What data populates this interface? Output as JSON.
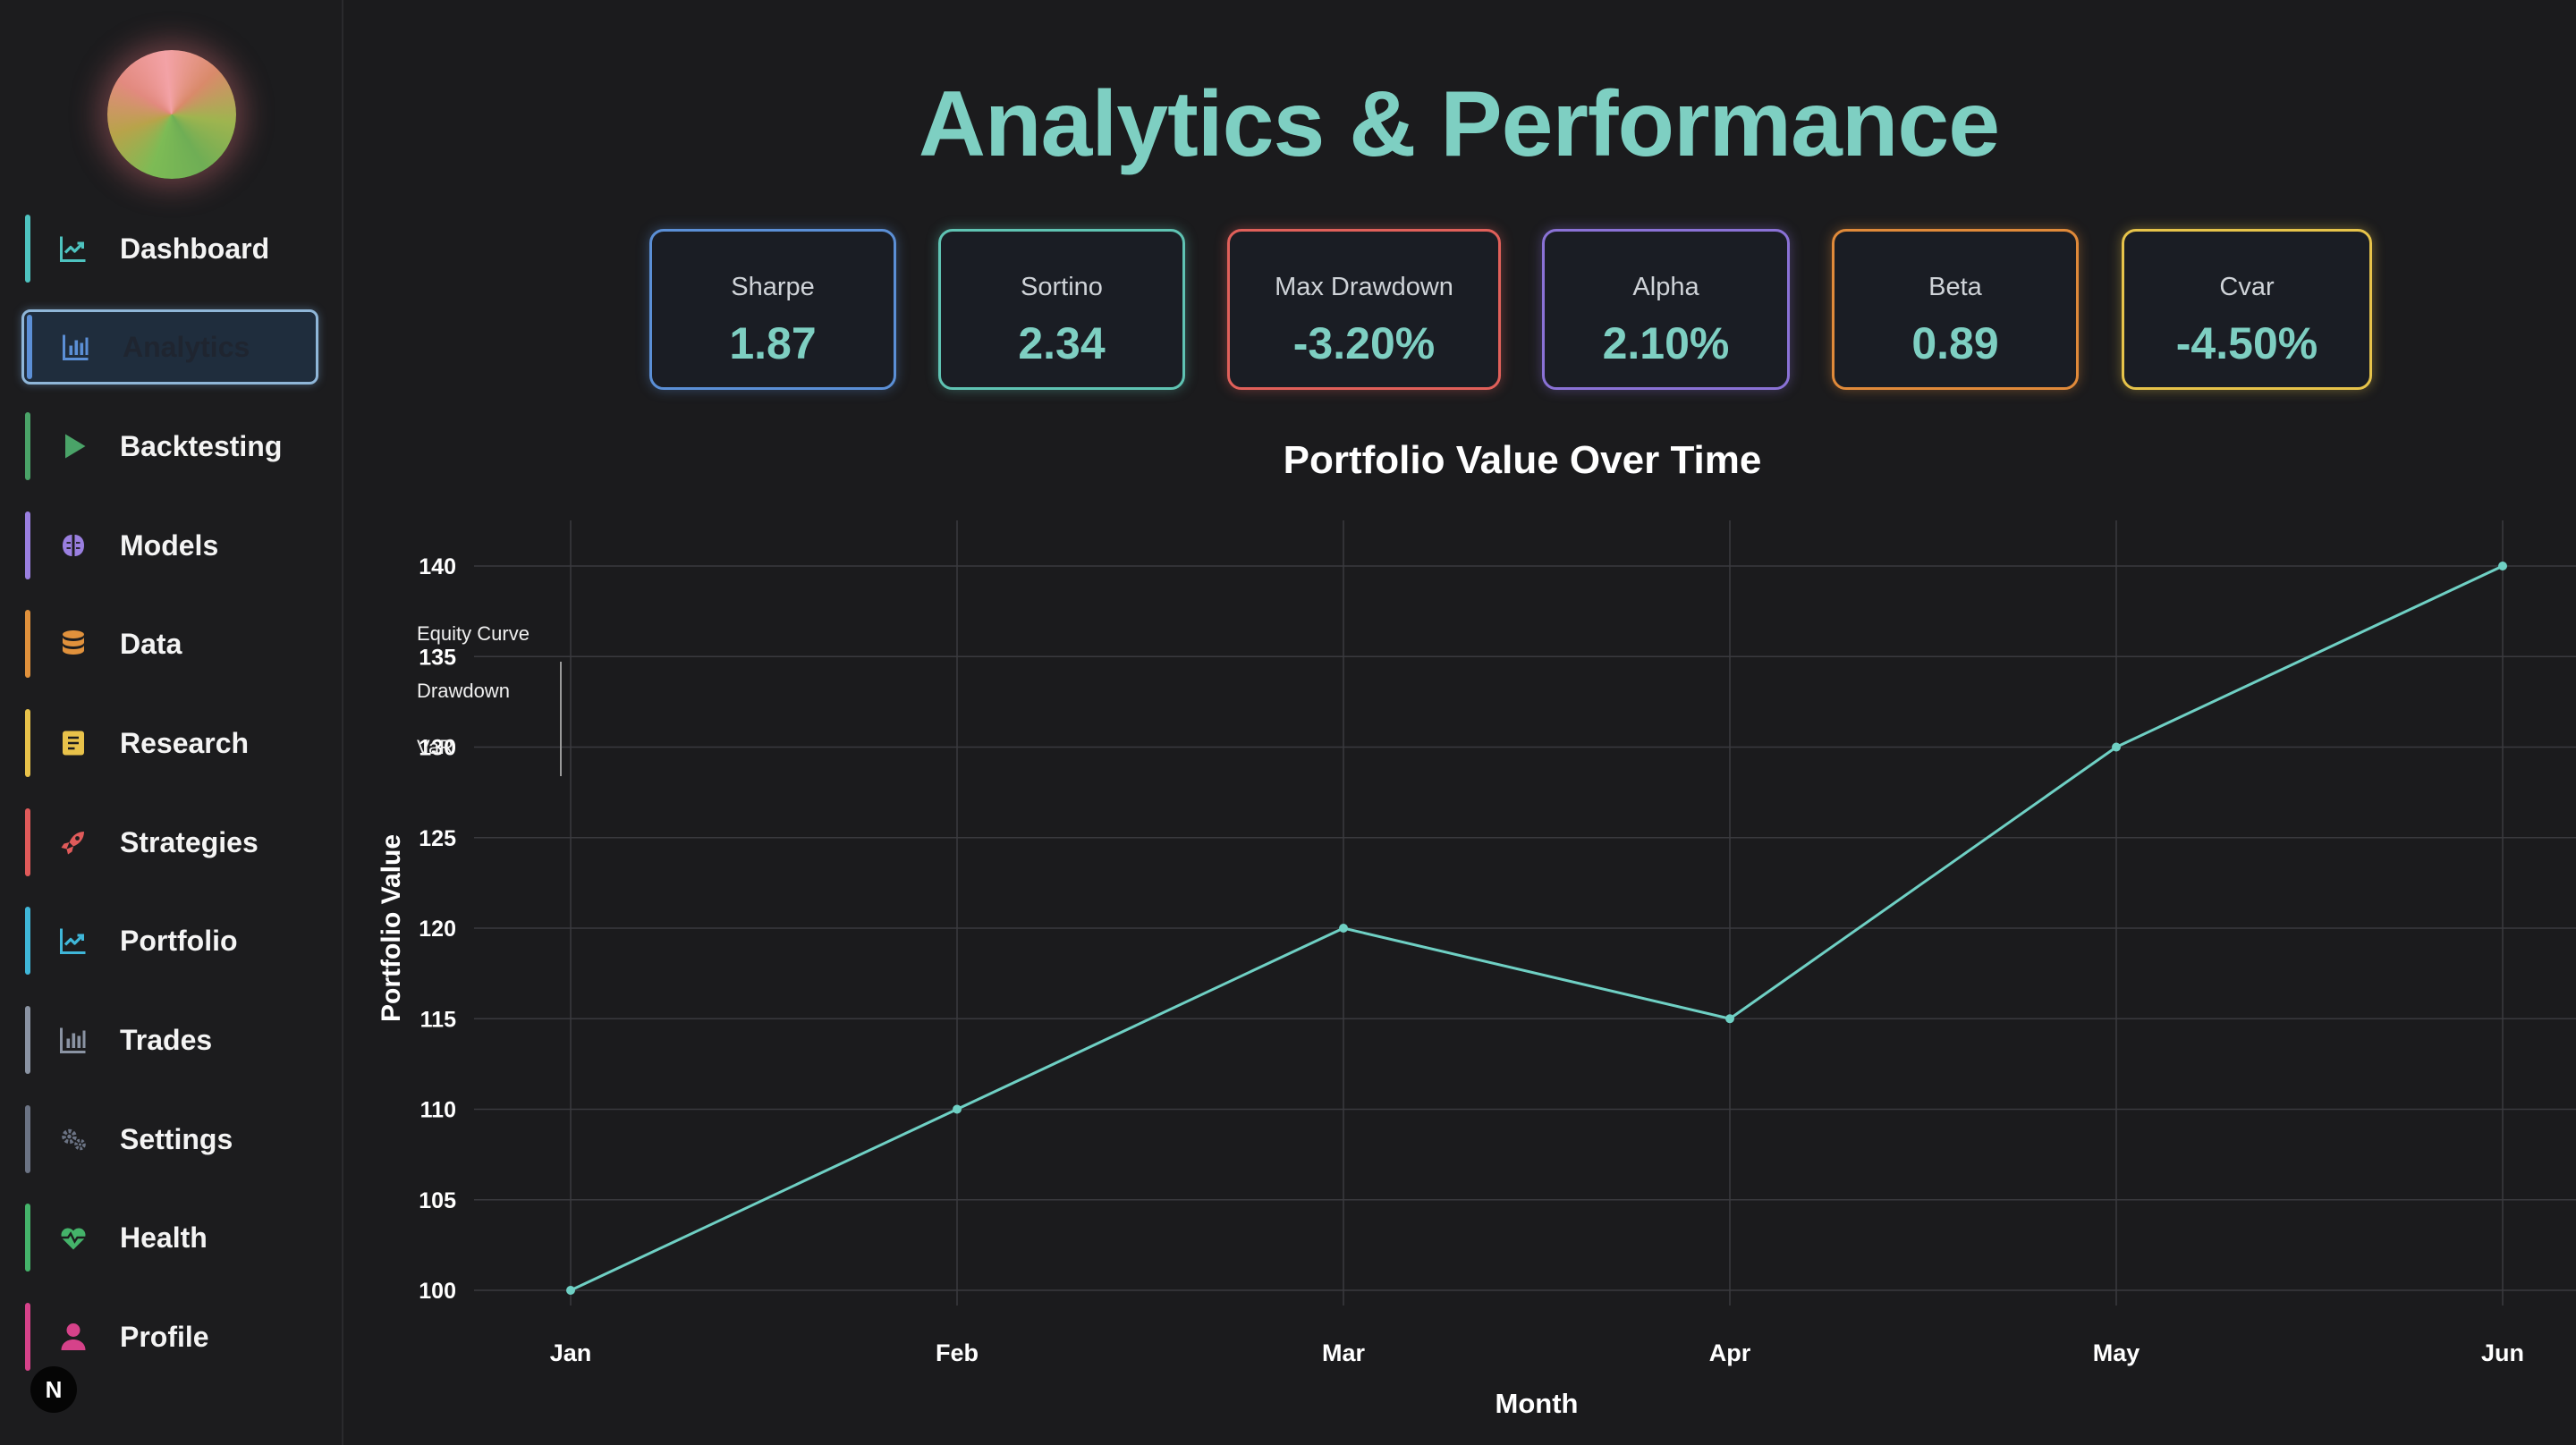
{
  "sidebar": {
    "items": [
      {
        "label": "Dashboard",
        "icon": "chart-line-icon",
        "color": "#4ec3c0",
        "active": false
      },
      {
        "label": "Analytics",
        "icon": "chart-bar-icon",
        "color": "#5b8fd6",
        "active": true
      },
      {
        "label": "Backtesting",
        "icon": "play-icon",
        "color": "#4aa368",
        "active": false
      },
      {
        "label": "Models",
        "icon": "brain-icon",
        "color": "#9a7fe0",
        "active": false
      },
      {
        "label": "Data",
        "icon": "database-icon",
        "color": "#e0913c",
        "active": false
      },
      {
        "label": "Research",
        "icon": "notebook-icon",
        "color": "#e8c24a",
        "active": false
      },
      {
        "label": "Strategies",
        "icon": "rocket-icon",
        "color": "#e05a5a",
        "active": false
      },
      {
        "label": "Portfolio",
        "icon": "chart-line-icon",
        "color": "#3fb6d8",
        "active": false
      },
      {
        "label": "Trades",
        "icon": "chart-bar-icon",
        "color": "#8a93a3",
        "active": false
      },
      {
        "label": "Settings",
        "icon": "gears-icon",
        "color": "#6b7384",
        "active": false
      },
      {
        "label": "Health",
        "icon": "heart-pulse-icon",
        "color": "#44b36a",
        "active": false
      },
      {
        "label": "Profile",
        "icon": "user-icon",
        "color": "#d6428a",
        "active": false
      }
    ],
    "badge": "N"
  },
  "header": {
    "title": "Analytics & Performance"
  },
  "metrics": [
    {
      "label": "Sharpe",
      "value": "1.87",
      "color": "#5b8fd6"
    },
    {
      "label": "Sortino",
      "value": "2.34",
      "color": "#5fc3b3"
    },
    {
      "label": "Max Drawdown",
      "value": "-3.20%",
      "color": "#e0605a"
    },
    {
      "label": "Alpha",
      "value": "2.10%",
      "color": "#8a72d6"
    },
    {
      "label": "Beta",
      "value": "0.89",
      "color": "#e08a3a"
    },
    {
      "label": "Cvar",
      "value": "-4.50%",
      "color": "#e6c34a"
    }
  ],
  "chart_data": {
    "type": "line",
    "title": "Portfolio Value Over Time",
    "xlabel": "Month",
    "ylabel": "Portfolio Value",
    "categories": [
      "Jan",
      "Feb",
      "Mar",
      "Apr",
      "May",
      "Jun"
    ],
    "yticks": [
      100,
      105,
      110,
      115,
      120,
      125,
      130,
      135,
      140
    ],
    "ylim": [
      100,
      140
    ],
    "grid": true,
    "legend": [
      "Equity Curve",
      "Drawdown",
      "VaR"
    ],
    "legend_placement": "top-left",
    "series": [
      {
        "name": "Equity Curve",
        "values": [
          100,
          110,
          120,
          115,
          130,
          140
        ],
        "color": "#6fd0c4"
      }
    ]
  }
}
